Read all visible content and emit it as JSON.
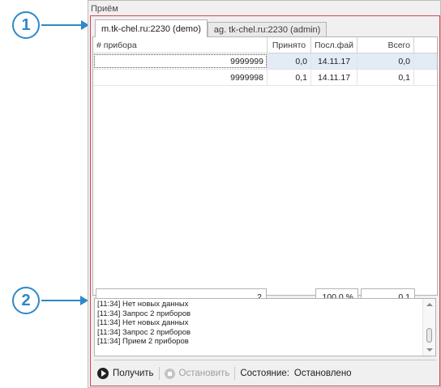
{
  "callouts": [
    "1",
    "2"
  ],
  "panel": {
    "title": "Приём"
  },
  "tabs": [
    {
      "label": "m.tk-chel.ru:2230 (demo)",
      "active": true
    },
    {
      "label": "ag. tk-chel.ru:2230 (admin)",
      "active": false
    }
  ],
  "grid": {
    "columns": [
      "# прибора",
      "Принято",
      "Посл.фай",
      "Всего",
      ""
    ],
    "rows": [
      [
        "9999999",
        "0,0",
        "14.11.17",
        "0,0"
      ],
      [
        "9999998",
        "0,1",
        "14.11.17",
        "0,1"
      ]
    ]
  },
  "totals": {
    "count": "2",
    "percent": "100,0 %",
    "total": "0,1"
  },
  "log": [
    "[11:34] Нет новых данных",
    "[11:34] Запрос 2 приборов",
    "[11:34] Нет новых данных",
    "[11:34] Запрос 2 приборов",
    "[11:34] Прием 2 приборов"
  ],
  "toolbar": {
    "get_label": "Получить",
    "stop_label": "Остановить",
    "state_label": "Состояние:",
    "state_value": "Остановлено"
  },
  "colors": {
    "accent": "#2e88c8",
    "frame": "#d9414b",
    "selection": "#e2ebf6"
  }
}
